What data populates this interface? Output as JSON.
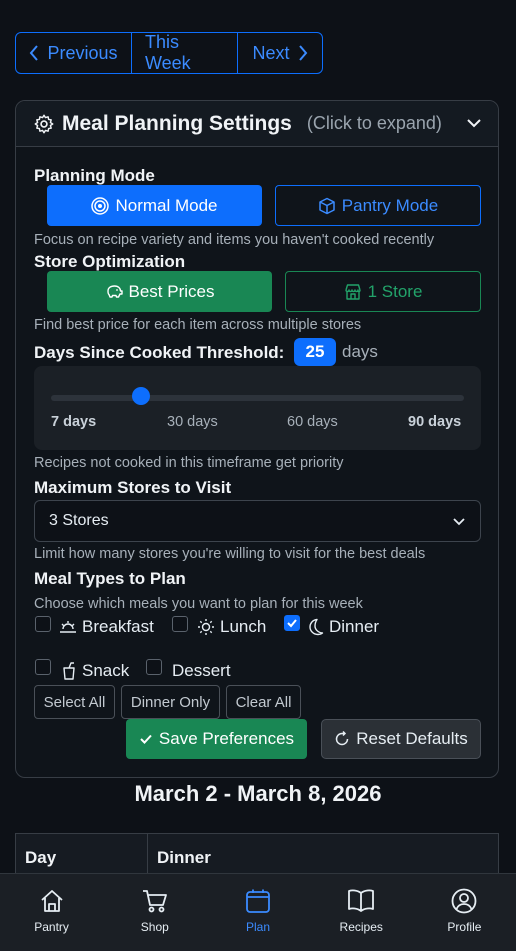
{
  "week_nav": {
    "previous": "Previous",
    "this_week": "This Week",
    "next": "Next"
  },
  "settings": {
    "title": "Meal Planning Settings",
    "hint": "(Click to expand)",
    "planning_mode": {
      "label": "Planning Mode",
      "normal": "Normal Mode",
      "pantry": "Pantry Mode",
      "selected": "Normal Mode",
      "help": "Focus on recipe variety and items you haven't cooked recently"
    },
    "store_opt": {
      "label": "Store Optimization",
      "best": "Best Prices",
      "one": "1 Store",
      "selected": "Best Prices",
      "help": "Find best price for each item across multiple stores"
    },
    "threshold": {
      "label": "Days Since Cooked Threshold:",
      "value": "25",
      "unit": "days",
      "level": 25,
      "min": 7,
      "max": 90,
      "ticks": [
        "7 days",
        "30 days",
        "60 days",
        "90 days"
      ],
      "help": "Recipes not cooked in this timeframe get priority"
    },
    "max_stores": {
      "label": "Maximum Stores to Visit",
      "value": "3 Stores",
      "help": "Limit how many stores you're willing to visit for the best deals"
    },
    "meal_types": {
      "label": "Meal Types to Plan",
      "help": "Choose which meals you want to plan for this week",
      "breakfast": "Breakfast",
      "lunch": "Lunch",
      "dinner": "Dinner",
      "snack": "Snack",
      "dessert": "Dessert",
      "checked": [
        "Dinner"
      ]
    },
    "quick": {
      "select_all": "Select All",
      "dinner_only": "Dinner Only",
      "clear_all": "Clear All"
    },
    "save": "Save Preferences",
    "reset": "Reset Defaults"
  },
  "plan": {
    "range": "March 2 - March 8, 2026",
    "columns": [
      "Day",
      "Dinner"
    ]
  },
  "bottom_nav": {
    "items": [
      "Pantry",
      "Shop",
      "Plan",
      "Recipes",
      "Profile"
    ],
    "active": "Plan"
  },
  "colors": {
    "primary": "#0d6efd",
    "success": "#198754",
    "background": "#0d1117"
  }
}
